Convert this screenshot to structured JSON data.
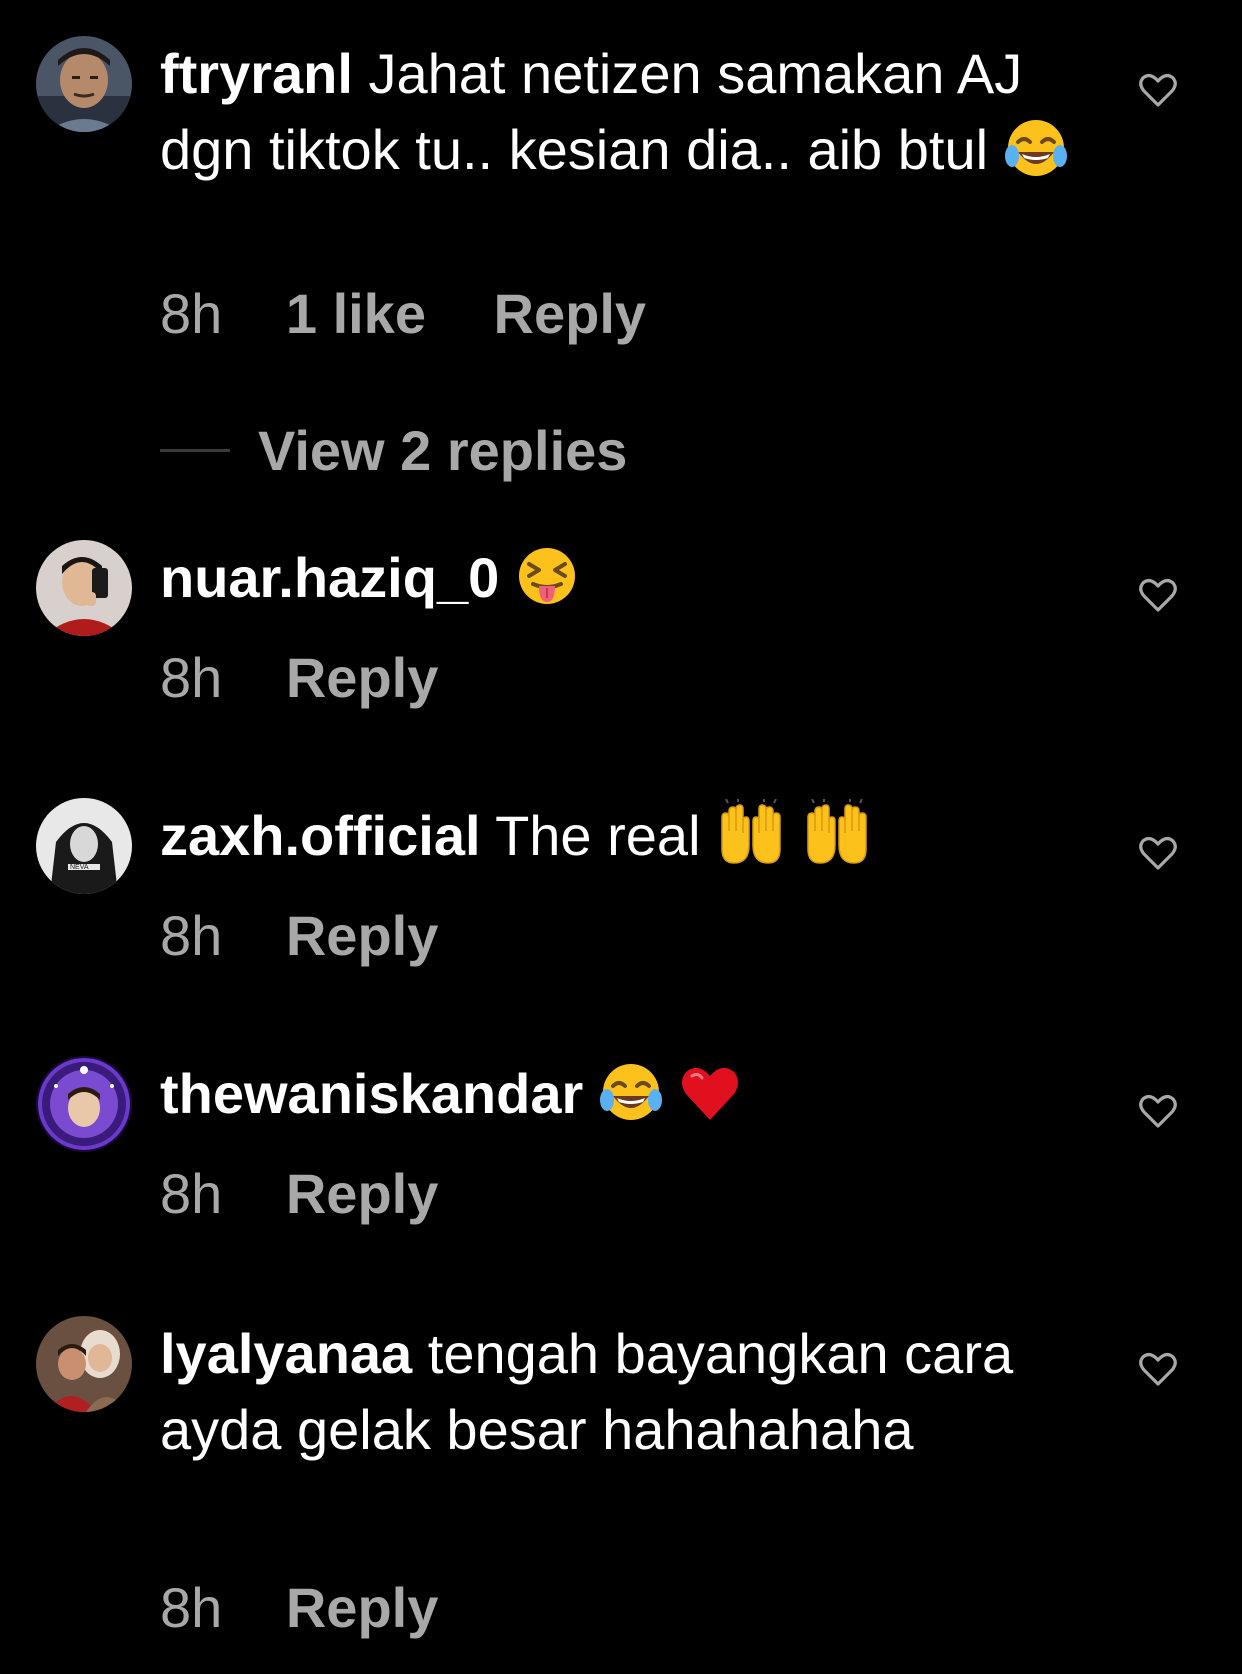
{
  "comments": [
    {
      "username": "ftryranl",
      "text": "Jahat netizen samakan AJ dgn tiktok tu.. kesian dia.. aib btul",
      "emoji": [
        "face-with-tears-of-joy"
      ],
      "time": "8h",
      "likes": "1 like",
      "reply": "Reply",
      "view_replies": "View 2 replies",
      "avatar_icon": "avatar-man-photo"
    },
    {
      "username": "nuar.haziq_0",
      "text": "",
      "emoji": [
        "squinting-face-with-tongue"
      ],
      "time": "8h",
      "reply": "Reply",
      "avatar_icon": "avatar-boy-selfie"
    },
    {
      "username": "zaxh.official",
      "text": "The real",
      "emoji": [
        "raising-hands",
        "raising-hands"
      ],
      "time": "8h",
      "reply": "Reply",
      "avatar_icon": "avatar-hooded-figure"
    },
    {
      "username": "thewaniskandar",
      "text": "",
      "emoji": [
        "face-with-tears-of-joy",
        "red-heart"
      ],
      "time": "8h",
      "reply": "Reply",
      "avatar_icon": "avatar-purple-frame"
    },
    {
      "username": "lyalyanaa",
      "text": "tengah bayangkan cara ayda gelak besar hahahahaha",
      "emoji": [],
      "time": "8h",
      "reply": "Reply",
      "avatar_icon": "avatar-family-photo"
    }
  ],
  "colors": {
    "background": "#000000",
    "primary_text": "#ffffff",
    "secondary_text": "#a8a8a8"
  }
}
